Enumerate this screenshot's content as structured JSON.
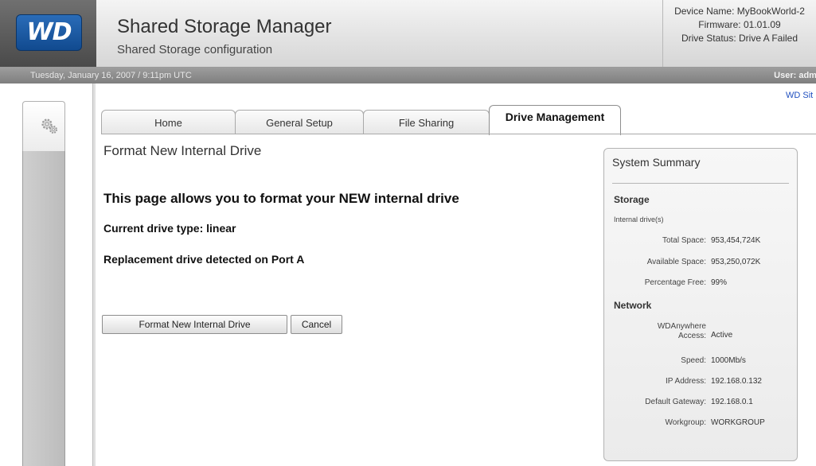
{
  "header": {
    "logo_text": "WD",
    "title": "Shared Storage Manager",
    "subtitle": "Shared Storage configuration",
    "device_name": "Device Name: MyBookWorld-2",
    "firmware": "Firmware: 01.01.09",
    "drive_status": "Drive Status: Drive A Failed"
  },
  "status_bar": {
    "datetime": "Tuesday, January 16, 2007 / 9:11pm UTC",
    "user": "User: admi"
  },
  "links": {
    "wd_site": "WD Sit"
  },
  "tabs": [
    {
      "label": "Home",
      "active": false
    },
    {
      "label": "General Setup",
      "active": false
    },
    {
      "label": "File Sharing",
      "active": false
    },
    {
      "label": "Drive Management",
      "active": true
    }
  ],
  "main": {
    "heading": "Format New Internal Drive",
    "intro": "This page allows you to format your NEW internal drive",
    "drive_type": "Current drive type: linear",
    "replacement": "Replacement drive detected on Port A",
    "format_button": "Format New Internal Drive",
    "cancel_button": "Cancel"
  },
  "summary": {
    "title": "System Summary",
    "storage_head": "Storage",
    "internal_drives": "Internal drive(s)",
    "storage_rows": [
      {
        "label": "Total Space:",
        "value": "953,454,724K"
      },
      {
        "label": "Available Space:",
        "value": "953,250,072K"
      },
      {
        "label": "Percentage Free:",
        "value": "99%"
      }
    ],
    "network_head": "Network",
    "network_rows": [
      {
        "label": "WDAnywhere Access:",
        "value": "Active"
      },
      {
        "label": "Speed:",
        "value": "1000Mb/s"
      },
      {
        "label": "IP Address:",
        "value": "192.168.0.132"
      },
      {
        "label": "Default Gateway:",
        "value": "192.168.0.1"
      },
      {
        "label": "Workgroup:",
        "value": "WORKGROUP"
      }
    ]
  },
  "colors": {
    "brand_blue": "#114a8f",
    "link_blue": "#1f4fbf",
    "status_bar": "#8a8a8a"
  },
  "icons": {
    "rail_icon": "gear-icon"
  }
}
